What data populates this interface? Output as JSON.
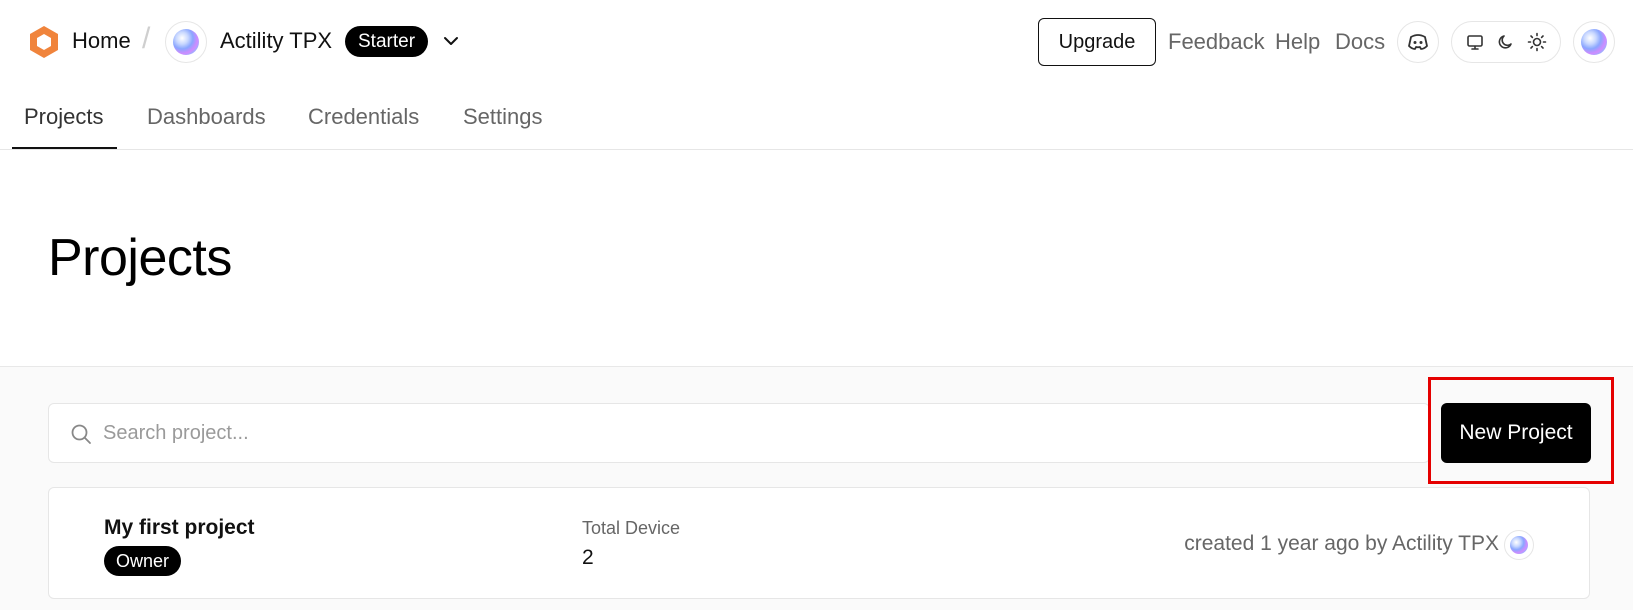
{
  "header": {
    "home_label": "Home",
    "separator": "/",
    "org_name": "Actility TPX",
    "plan_badge": "Starter",
    "upgrade_label": "Upgrade",
    "links": {
      "feedback": "Feedback",
      "help": "Help",
      "docs": "Docs"
    },
    "icons": {
      "logo": "hexagon-logo-icon",
      "org_chevron": "chevron-down-icon",
      "discord": "discord-icon",
      "theme_system": "monitor-icon",
      "theme_dark": "moon-icon",
      "theme_light": "sun-icon"
    }
  },
  "tabs": [
    {
      "label": "Projects",
      "active": true
    },
    {
      "label": "Dashboards",
      "active": false
    },
    {
      "label": "Credentials",
      "active": false
    },
    {
      "label": "Settings",
      "active": false
    }
  ],
  "page": {
    "title": "Projects"
  },
  "search": {
    "placeholder": "Search project...",
    "value": ""
  },
  "new_project_label": "New Project",
  "projects": [
    {
      "name": "My first project",
      "role": "Owner",
      "stat_label": "Total Device",
      "stat_value": "2",
      "created": "created 1 year ago by Actility TPX"
    }
  ],
  "colors": {
    "brand": "#f0843c",
    "highlight": "#e50000",
    "primary": "#000000"
  }
}
